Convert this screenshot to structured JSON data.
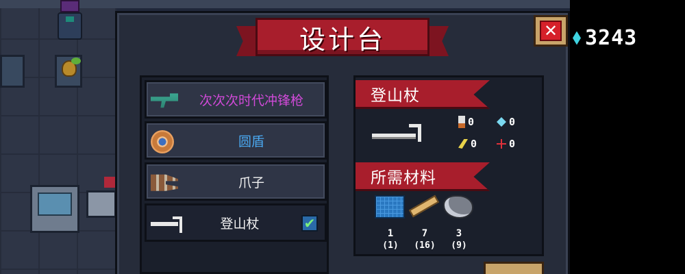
{
  "title": "设计台",
  "close_label": "✕",
  "gems": "3243",
  "items": [
    {
      "label": "次次次时代冲锋枪",
      "color": "#d04ad8",
      "icon": "smg-icon"
    },
    {
      "label": "圆盾",
      "color": "#4aa8f0",
      "icon": "round-shield-icon"
    },
    {
      "label": "爪子",
      "color": "#f2f2f2",
      "icon": "claw-icon"
    },
    {
      "label": "登山杖",
      "color": "#f2f2f2",
      "icon": "climbing-staff-icon",
      "checked": "✔"
    }
  ],
  "detail": {
    "name": "登山杖",
    "stats": {
      "damage": "0",
      "energy": "0",
      "crit": "0",
      "spread": "0"
    },
    "materials_title": "所需材料",
    "materials": [
      {
        "icon": "blueprint-icon",
        "need": "1",
        "have": "(1)"
      },
      {
        "icon": "wood-icon",
        "need": "7",
        "have": "(16)"
      },
      {
        "icon": "ore-icon",
        "need": "3",
        "have": "(9)"
      }
    ]
  }
}
